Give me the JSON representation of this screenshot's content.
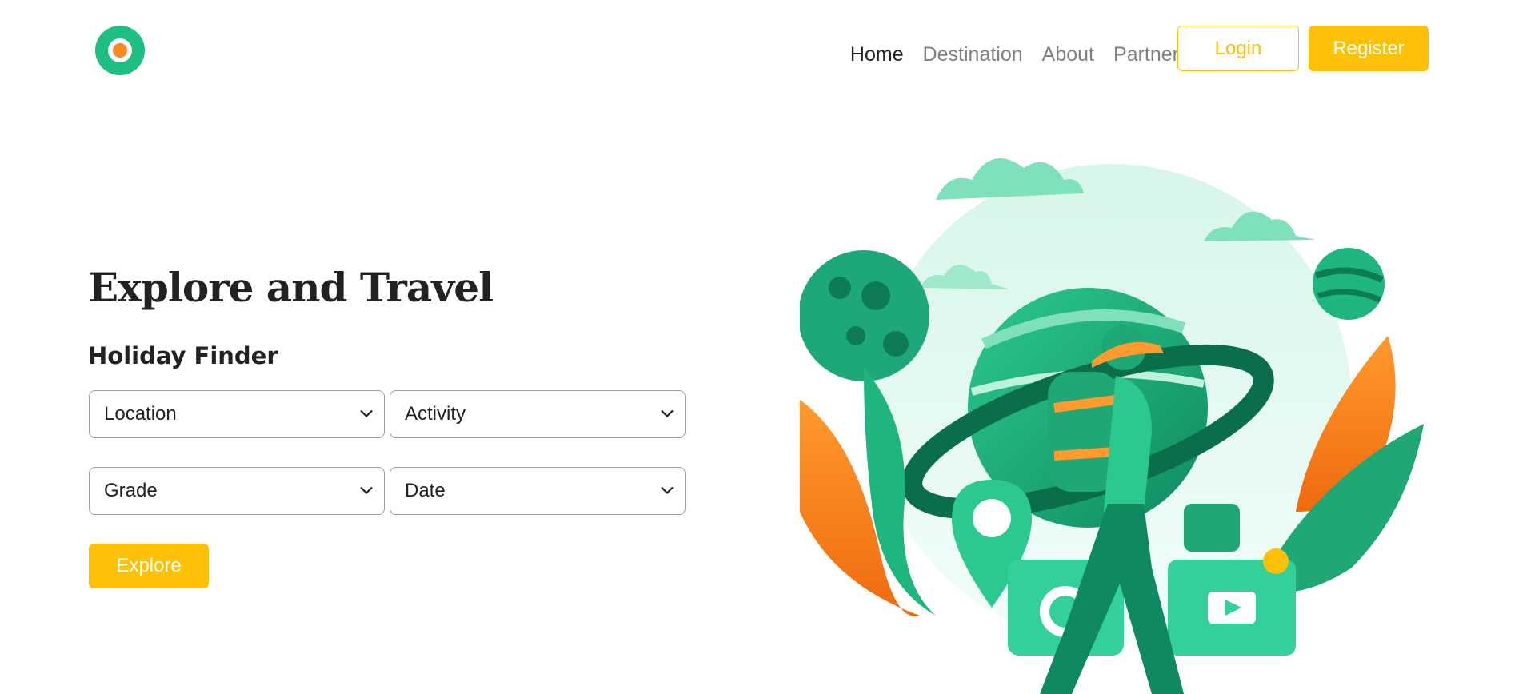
{
  "header": {
    "nav": [
      {
        "label": "Home"
      },
      {
        "label": "Destination"
      },
      {
        "label": "About"
      },
      {
        "label": "Partner"
      }
    ],
    "login_label": "Login",
    "register_label": "Register"
  },
  "hero": {
    "title": "Explore and Travel",
    "finder_title": "Holiday Finder",
    "selects": {
      "location": "Location",
      "activity": "Activity",
      "grade": "Grade",
      "date": "Date"
    },
    "explore_label": "Explore"
  },
  "colors": {
    "accent": "#ffc107",
    "brand_green": "#1fbf84",
    "brand_orange": "#f58a1f"
  },
  "icons": [
    "logo-icon",
    "chevron-down-icon",
    "traveler-illustration"
  ]
}
